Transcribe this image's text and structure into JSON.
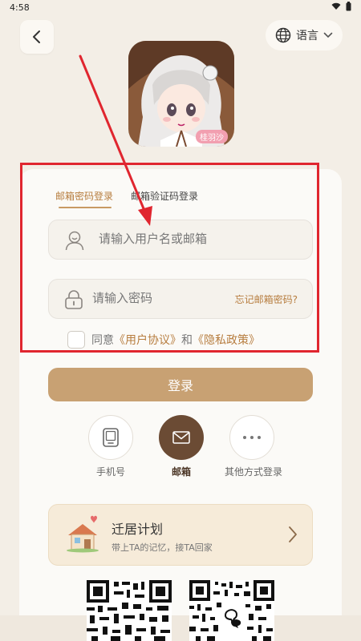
{
  "status_bar": {
    "time": "4:58"
  },
  "header": {
    "language_label": "语言"
  },
  "avatar": {
    "badge_text": "桂羽沙"
  },
  "login_tabs": [
    {
      "label": "邮箱密码登录",
      "active": true
    },
    {
      "label": "邮箱验证码登录",
      "active": false
    }
  ],
  "username_field": {
    "placeholder": "请输入用户名或邮箱",
    "value": ""
  },
  "password_field": {
    "placeholder": "请输入密码",
    "value": "",
    "forgot_label": "忘记邮箱密码?"
  },
  "agreement": {
    "checked": false,
    "prefix": "同意",
    "user_agreement": "《用户协议》",
    "conjunction": "和",
    "privacy_policy": "《隐私政策》"
  },
  "login_button": {
    "label": "登录"
  },
  "alt_login": [
    {
      "label": "手机号",
      "icon": "tablet-icon"
    },
    {
      "label": "邮箱",
      "icon": "mail-icon",
      "active": true
    },
    {
      "label": "其他方式登录",
      "icon": "more-dots-icon"
    }
  ],
  "migration_plan": {
    "title": "迁居计划",
    "subtitle": "带上TA的记忆，接TA回家"
  },
  "colors": {
    "accent": "#c89a63",
    "link": "#b77d3f",
    "annotation": "#e0262f",
    "mail_active": "#6b4b34"
  }
}
